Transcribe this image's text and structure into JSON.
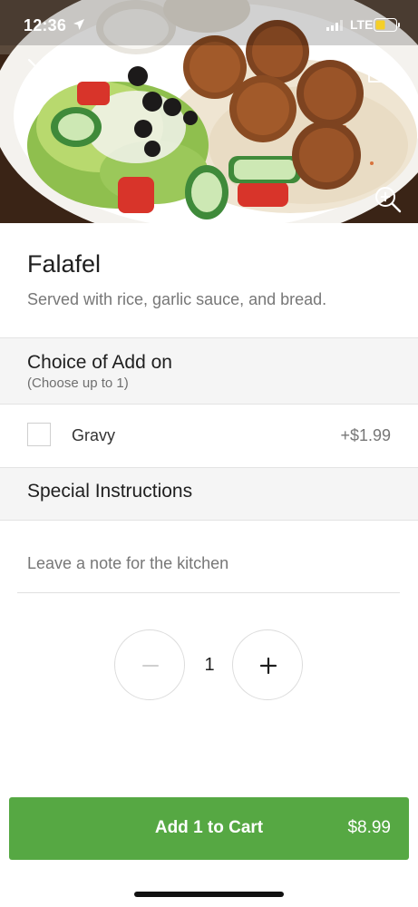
{
  "status_bar": {
    "time": "12:36",
    "network": "LTE"
  },
  "header": {
    "close_icon": "close-icon",
    "share_icon": "share-icon",
    "zoom_icon": "zoom-in-icon"
  },
  "item": {
    "title": "Falafel",
    "description": "Served with rice, garlic sauce, and bread."
  },
  "add_on_section": {
    "title": "Choice of Add on",
    "subtitle": "(Choose up to 1)",
    "options": [
      {
        "label": "Gravy",
        "price": "+$1.99",
        "checked": false
      }
    ]
  },
  "special_instructions": {
    "title": "Special Instructions",
    "placeholder": "Leave a note for the kitchen"
  },
  "quantity": {
    "value": "1"
  },
  "cart_button": {
    "label": "Add 1 to Cart",
    "price": "$8.99",
    "color": "#56a843"
  }
}
